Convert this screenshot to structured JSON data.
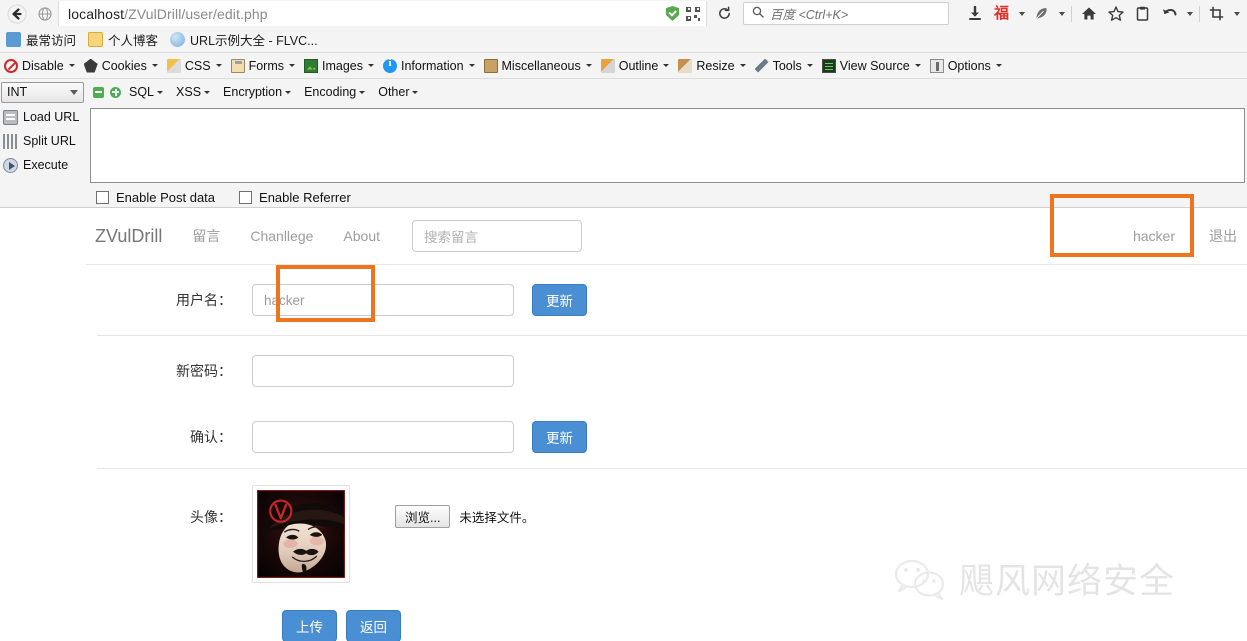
{
  "browser": {
    "url_prefix": "localhost",
    "url_path": "/ZVulDrill/user/edit.php",
    "search_placeholder": "百度 <Ctrl+K>",
    "back_icon": "back-arrow-icon",
    "identity_icon": "globe-icon",
    "shield_icon": "shield-check-icon",
    "qr_icon": "qr-code-icon",
    "reload_icon": "reload-icon",
    "search_icon": "search-icon",
    "toolbar_icons": [
      "download-icon",
      "fu-character-icon",
      "dropdown-caret-icon",
      "feather-icon",
      "dropdown-caret-icon",
      "home-icon",
      "star-icon",
      "clipboard-icon",
      "undo-icon",
      "dropdown-caret-icon",
      "crop-icon",
      "dropdown-caret-icon"
    ]
  },
  "bookmarks": [
    {
      "label": "最常访问",
      "icon": "most-visited-icon"
    },
    {
      "label": "个人博客",
      "icon": "folder-icon"
    },
    {
      "label": "URL示例大全 - FLVC...",
      "icon": "globe-icon"
    }
  ],
  "webdev_toolbar": [
    {
      "label": "Disable",
      "icon": "disable-icon",
      "has_caret": true
    },
    {
      "label": "Cookies",
      "icon": "cookies-icon",
      "has_caret": true
    },
    {
      "label": "CSS",
      "icon": "css-icon",
      "has_caret": true
    },
    {
      "label": "Forms",
      "icon": "forms-icon",
      "has_caret": true
    },
    {
      "label": "Images",
      "icon": "images-icon",
      "has_caret": true
    },
    {
      "label": "Information",
      "icon": "information-icon",
      "has_caret": true
    },
    {
      "label": "Miscellaneous",
      "icon": "miscellaneous-icon",
      "has_caret": true
    },
    {
      "label": "Outline",
      "icon": "outline-icon",
      "has_caret": true
    },
    {
      "label": "Resize",
      "icon": "resize-icon",
      "has_caret": true
    },
    {
      "label": "Tools",
      "icon": "tools-icon",
      "has_caret": true
    },
    {
      "label": "View Source",
      "icon": "view-source-icon",
      "has_caret": true
    },
    {
      "label": "Options",
      "icon": "options-icon",
      "has_caret": true
    }
  ],
  "hackbar": {
    "type_select": "INT",
    "minus_icon": "minus-icon",
    "plus_icon": "plus-icon",
    "menus": [
      {
        "label": "SQL"
      },
      {
        "label": "XSS"
      },
      {
        "label": "Encryption"
      },
      {
        "label": "Encoding"
      },
      {
        "label": "Other"
      }
    ],
    "actions": [
      {
        "label": "Load URL",
        "icon": "load-url-icon"
      },
      {
        "label": "Split URL",
        "icon": "split-url-icon"
      },
      {
        "label": "Execute",
        "icon": "execute-icon"
      }
    ],
    "textarea_value": "",
    "checkboxes": [
      {
        "label": "Enable Post data",
        "checked": false
      },
      {
        "label": "Enable Referrer",
        "checked": false
      }
    ]
  },
  "site": {
    "brand": "ZVulDrill",
    "nav_links": [
      {
        "label": "留言"
      },
      {
        "label": "Chanllege"
      },
      {
        "label": "About"
      }
    ],
    "search_placeholder": "搜索留言",
    "user_name": "hacker",
    "logout_label": "退出"
  },
  "form": {
    "username_label": "用户名：",
    "username_value": "hacker",
    "username_update_label": "更新",
    "new_password_label": "新密码：",
    "new_password_value": "",
    "confirm_label": "确认：",
    "confirm_value": "",
    "password_update_label": "更新",
    "avatar_label": "头像：",
    "avatar_alt": "guy-fawkes-mask-avatar",
    "browse_label": "浏览...",
    "file_status": "未选择文件。",
    "upload_label": "上传",
    "back_label": "返回"
  },
  "watermark": {
    "icon": "wechat-icon",
    "text": "飓风网络安全"
  },
  "colors": {
    "highlight": "#ee7420",
    "primary_button": "#4a8fd4",
    "nav_text": "#9d9d9d"
  }
}
